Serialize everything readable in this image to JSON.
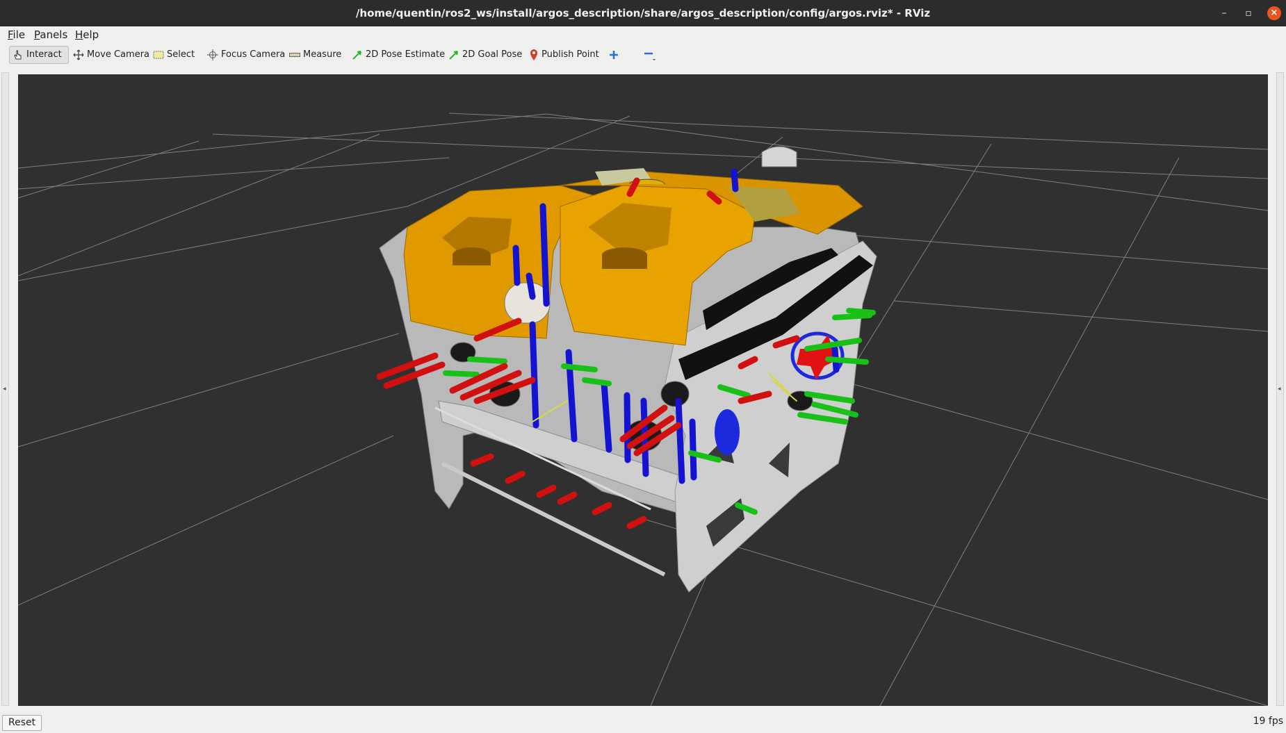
{
  "window": {
    "title": "/home/quentin/ros2_ws/install/argos_description/share/argos_description/config/argos.rviz* - RViz",
    "minimize_glyph": "–",
    "maximize_glyph": "▫",
    "close_glyph": "×"
  },
  "menu": {
    "file": {
      "key": "F",
      "rest": "ile"
    },
    "panels": {
      "key": "P",
      "rest": "anels"
    },
    "help": {
      "key": "H",
      "rest": "elp"
    }
  },
  "toolbar": {
    "interact": "Interact",
    "move_camera": "Move Camera",
    "select": "Select",
    "focus_camera": "Focus Camera",
    "measure": "Measure",
    "pose_estimate": "2D Pose Estimate",
    "goal_pose": "2D Goal Pose",
    "publish_point": "Publish Point",
    "add_tool_icon": "plus-icon",
    "remove_tool_icon": "minus-icon"
  },
  "side_handles": {
    "left": "◂",
    "right": "◂"
  },
  "status": {
    "reset": "Reset",
    "fps": "19 fps"
  },
  "colors": {
    "viewport_bg": "#303030",
    "grid": "#9a9a9a",
    "robot_hull": "#e09a00",
    "frame": "#c8c8c8",
    "axis_x": "#d11010",
    "axis_y": "#18c018",
    "axis_z": "#1414d0",
    "close_button": "#e95420"
  }
}
